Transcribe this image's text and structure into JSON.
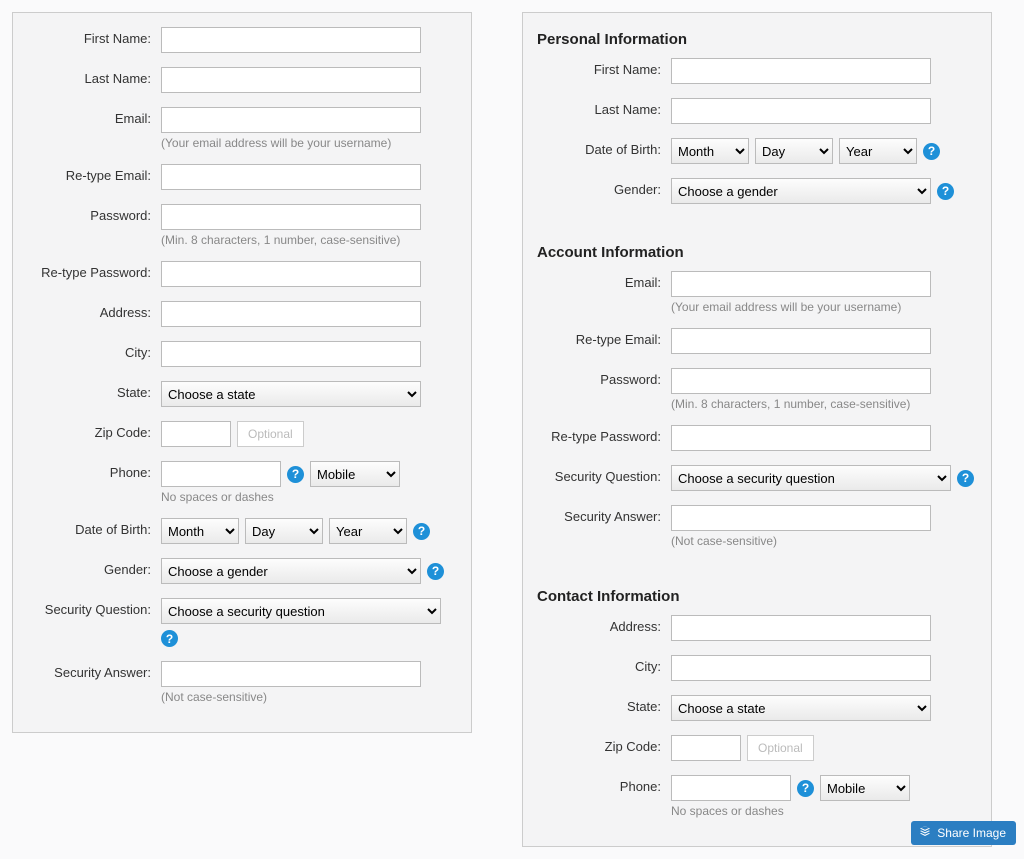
{
  "left": {
    "firstName": {
      "label": "First Name:"
    },
    "lastName": {
      "label": "Last Name:"
    },
    "email": {
      "label": "Email:",
      "hint": "(Your email address will be your username)"
    },
    "reEmail": {
      "label": "Re-type Email:"
    },
    "password": {
      "label": "Password:",
      "hint": "(Min. 8 characters, 1 number, case-sensitive)"
    },
    "rePassword": {
      "label": "Re-type Password:"
    },
    "address": {
      "label": "Address:"
    },
    "city": {
      "label": "City:"
    },
    "state": {
      "label": "State:",
      "opt": "Choose a state"
    },
    "zip": {
      "label": "Zip Code:",
      "optBtn": "Optional"
    },
    "phone": {
      "label": "Phone:",
      "hint": "No spaces or dashes",
      "typeOpt": "Mobile"
    },
    "dob": {
      "label": "Date of Birth:",
      "month": "Month",
      "day": "Day",
      "year": "Year"
    },
    "gender": {
      "label": "Gender:",
      "opt": "Choose a gender"
    },
    "secQ": {
      "label": "Security Question:",
      "opt": "Choose a security question"
    },
    "secA": {
      "label": "Security Answer:",
      "hint": "(Not case-sensitive)"
    }
  },
  "right": {
    "personal": {
      "heading": "Personal Information",
      "firstName": {
        "label": "First Name:"
      },
      "lastName": {
        "label": "Last Name:"
      },
      "dob": {
        "label": "Date of Birth:",
        "month": "Month",
        "day": "Day",
        "year": "Year"
      },
      "gender": {
        "label": "Gender:",
        "opt": "Choose a gender"
      }
    },
    "account": {
      "heading": "Account Information",
      "email": {
        "label": "Email:",
        "hint": "(Your email address will be your username)"
      },
      "reEmail": {
        "label": "Re-type Email:"
      },
      "password": {
        "label": "Password:",
        "hint": "(Min. 8 characters, 1 number, case-sensitive)"
      },
      "rePassword": {
        "label": "Re-type Password:"
      },
      "secQ": {
        "label": "Security Question:",
        "opt": "Choose a security question"
      },
      "secA": {
        "label": "Security Answer:",
        "hint": "(Not case-sensitive)"
      }
    },
    "contact": {
      "heading": "Contact Information",
      "address": {
        "label": "Address:"
      },
      "city": {
        "label": "City:"
      },
      "state": {
        "label": "State:",
        "opt": "Choose a state"
      },
      "zip": {
        "label": "Zip Code:",
        "optBtn": "Optional"
      },
      "phone": {
        "label": "Phone:",
        "hint": "No spaces or dashes",
        "typeOpt": "Mobile"
      }
    }
  },
  "shareButton": "Share Image",
  "helpGlyph": "?"
}
